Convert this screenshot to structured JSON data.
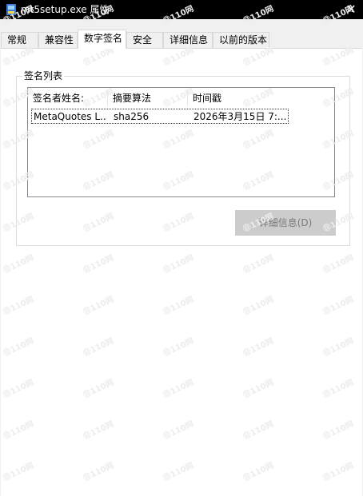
{
  "window": {
    "title": "mt5setup.exe 属性",
    "close_glyph": "✕"
  },
  "tabs": [
    {
      "label": "常规"
    },
    {
      "label": "兼容性"
    },
    {
      "label": "数字签名",
      "active": true
    },
    {
      "label": "安全"
    },
    {
      "label": "详细信息"
    },
    {
      "label": "以前的版本"
    }
  ],
  "signatures": {
    "group_label": "签名列表",
    "columns": [
      "签名者姓名:",
      "摘要算法",
      "时间戳"
    ],
    "rows": [
      {
        "name": "MetaQuotes L...",
        "algorithm": "sha256",
        "timestamp": "2026年3月15日 7:..."
      }
    ],
    "details_button": "详细信息(D)"
  },
  "watermark": "㊐110网",
  "colors": {
    "titlebar": "#000000",
    "tab_active": "#ffffff",
    "button_disabled": "#cccccc"
  }
}
